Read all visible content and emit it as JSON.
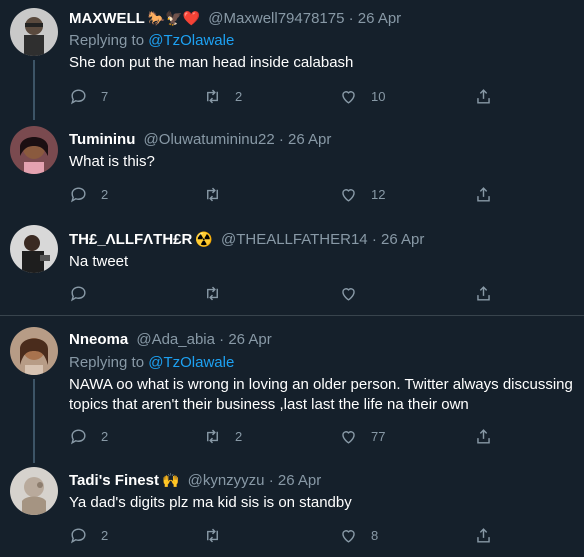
{
  "tweets": [
    {
      "name": "MAXWELL",
      "name_emoji": "🐎🦅❤️",
      "handle": "@Maxwell79478175",
      "separator": "·",
      "date": "26 Apr",
      "replying_label": "Replying to",
      "replying_to": "@TzOlawale",
      "text": "She don put the man head inside calabash",
      "replies": "7",
      "retweets": "2",
      "likes": "10"
    },
    {
      "name": "Tumininu",
      "handle": "@Oluwatumininu22",
      "separator": "·",
      "date": "26 Apr",
      "text": "What is this?",
      "replies": "2",
      "retweets": "",
      "likes": "12"
    },
    {
      "name": "TH£_ΛLLFΛTH£R",
      "name_emoji": "☢️",
      "handle": "@THEALLFATHER14",
      "separator": "·",
      "date": "26 Apr",
      "text": "Na tweet",
      "replies": "",
      "retweets": "",
      "likes": ""
    },
    {
      "name": "Nneoma",
      "handle": "@Ada_abia",
      "separator": "·",
      "date": "26 Apr",
      "replying_label": "Replying to",
      "replying_to": "@TzOlawale",
      "text": "NAWA oo what is wrong in loving an older person. Twitter always discussing topics that aren't their business ,last last the life na their own",
      "replies": "2",
      "retweets": "2",
      "likes": "77"
    },
    {
      "name": "Tadi's Finest",
      "name_emoji": "🙌",
      "handle": "@kynzyyzu",
      "separator": "·",
      "date": "26 Apr",
      "text": "Ya dad's digits plz ma kid sis is on standby",
      "replies": "2",
      "retweets": "",
      "likes": "8"
    }
  ],
  "icons": {
    "reply": "reply-icon",
    "retweet": "retweet-icon",
    "like": "heart-icon",
    "share": "share-icon"
  },
  "colors": {
    "background": "#15202b",
    "secondary_text": "#8899a6",
    "link": "#1da1f2",
    "divider": "#38444d"
  }
}
